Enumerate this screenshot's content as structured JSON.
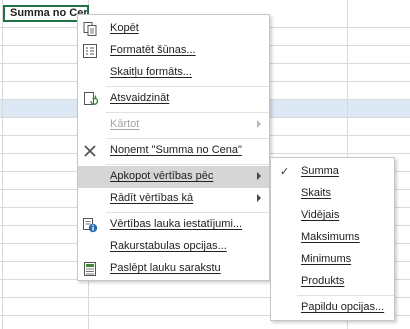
{
  "cell": {
    "label": "Summa no Cena"
  },
  "context_menu": {
    "items": [
      {
        "label": "Kopēt",
        "icon": "copy-icon"
      },
      {
        "label": "Formatēt šūnas...",
        "icon": "format-cells-icon"
      },
      {
        "label": "Skaitļu formāts..."
      },
      {
        "label": "Atsvaidzināt",
        "icon": "refresh-icon"
      },
      {
        "label": "Kārtot",
        "disabled": true
      },
      {
        "label": "Noņemt \"Summa no Cena\"",
        "icon": "close-icon"
      },
      {
        "label": "Apkopot vērtības pēc",
        "highlighted": true
      },
      {
        "label": "Rādīt vērtības kā"
      },
      {
        "label": "Vērtības lauka iestatījumi...",
        "icon": "field-settings-icon"
      },
      {
        "label": "Rakurstabulas opcijas..."
      },
      {
        "label": "Paslēpt lauku sarakstu",
        "icon": "field-list-icon"
      }
    ]
  },
  "submenu": {
    "check_mark": "✓",
    "items": [
      {
        "label": "Summa",
        "checked": true
      },
      {
        "label": "Skaits"
      },
      {
        "label": "Vidējais"
      },
      {
        "label": "Maksimums"
      },
      {
        "label": "Minimums"
      },
      {
        "label": "Produkts"
      },
      {
        "label": "Papildu opcijas..."
      }
    ]
  },
  "colors": {
    "accent": "#217346",
    "highlight": "#d6d6d6",
    "band": "#dde8f5"
  }
}
